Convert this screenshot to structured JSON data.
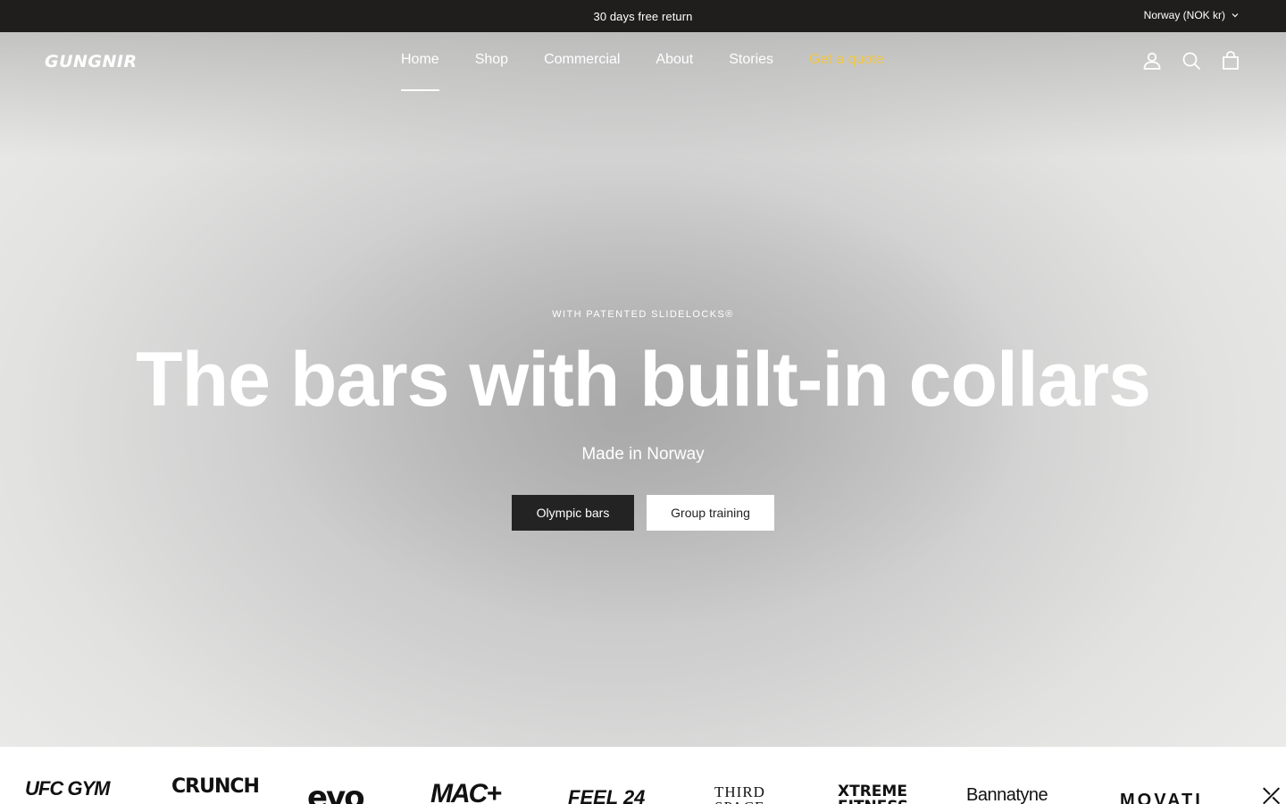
{
  "announcement": {
    "text": "30 days free return",
    "country": "Norway (NOK kr)"
  },
  "header": {
    "logo": "GUNGNIR",
    "nav": [
      {
        "label": "Home",
        "active": true
      },
      {
        "label": "Shop"
      },
      {
        "label": "Commercial"
      },
      {
        "label": "About"
      },
      {
        "label": "Stories"
      },
      {
        "label": "Get a quote"
      }
    ],
    "icons": [
      "account-icon",
      "search-icon",
      "cart-icon"
    ]
  },
  "hero": {
    "eyebrow": "WITH PATENTED SLIDELOCKS®",
    "headline": "The bars with built-in collars",
    "subtitle": "Made in Norway",
    "buttons": {
      "primary": "Olympic bars",
      "secondary": "Group training"
    }
  },
  "logos": [
    "UFC GYM",
    "CRUNCH",
    "evo",
    "MAC+",
    "FEEL 24",
    "THIRD SPACE",
    "XTREME FITNESS",
    "Bannatyne",
    "MOVATI"
  ],
  "colors": {
    "announcement_bg": "#1f1e1c",
    "accent_quote": "#f2c744",
    "button_dark": "#232323"
  }
}
